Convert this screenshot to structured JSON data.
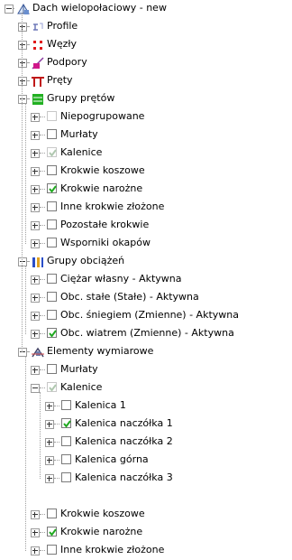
{
  "tree": {
    "root": {
      "label": "Dach wielopołaciowy - new",
      "icon": "roof-model-icon"
    },
    "level1": [
      {
        "label": "Profile",
        "icon": "profile-icon"
      },
      {
        "label": "Węzły",
        "icon": "nodes-icon"
      },
      {
        "label": "Podpory",
        "icon": "supports-icon"
      },
      {
        "label": "Pręty",
        "icon": "bars-icon"
      },
      {
        "label": "Grupy prętów",
        "icon": "bar-groups-icon"
      },
      {
        "label": "Grupy obciążeń",
        "icon": "load-groups-icon"
      },
      {
        "label": "Elementy wymiarowe",
        "icon": "design-elements-icon"
      }
    ],
    "bar_groups": [
      {
        "label": "Niepogrupowane",
        "checked": false,
        "faded": true
      },
      {
        "label": "Murłaty",
        "checked": false,
        "faded": false
      },
      {
        "label": "Kalenice",
        "checked": true,
        "faded": true
      },
      {
        "label": "Krokwie koszowe",
        "checked": false,
        "faded": false
      },
      {
        "label": "Krokwie narożne",
        "checked": true,
        "faded": false
      },
      {
        "label": "Inne krokwie złożone",
        "checked": false,
        "faded": false
      },
      {
        "label": "Pozostałe krokwie",
        "checked": false,
        "faded": false
      },
      {
        "label": "Wsporniki okapów",
        "checked": false,
        "faded": false
      }
    ],
    "load_groups": [
      {
        "label": "Ciężar własny - Aktywna",
        "checked": false,
        "faded": false
      },
      {
        "label": "Obc. stałe (Stałe) - Aktywna",
        "checked": false,
        "faded": false
      },
      {
        "label": "Obc. śniegiem (Zmienne) - Aktywna",
        "checked": false,
        "faded": false
      },
      {
        "label": "Obc. wiatrem (Zmienne) - Aktywna",
        "checked": true,
        "faded": false
      }
    ],
    "design_elements": [
      {
        "label": "Murłaty",
        "checked": false,
        "faded": false
      },
      {
        "label": "Kalenice",
        "checked": true,
        "faded": true
      }
    ],
    "kalenice_children": [
      {
        "label": "Kalenica 1",
        "checked": false,
        "faded": false
      },
      {
        "label": "Kalenica naczółka 1",
        "checked": true,
        "faded": false
      },
      {
        "label": "Kalenica naczółka 2",
        "checked": false,
        "faded": false
      },
      {
        "label": "Kalenica górna",
        "checked": false,
        "faded": false
      },
      {
        "label": "Kalenica naczółka 3",
        "checked": false,
        "faded": false
      }
    ],
    "design_elements_tail": [
      {
        "label": "Krokwie koszowe",
        "checked": false,
        "faded": false
      },
      {
        "label": "Krokwie narożne",
        "checked": true,
        "faded": false
      },
      {
        "label": "Inne krokwie złożone",
        "checked": false,
        "faded": false
      }
    ]
  },
  "colors": {
    "check": "#22aa22",
    "check_faded": "#b0c8b0"
  }
}
